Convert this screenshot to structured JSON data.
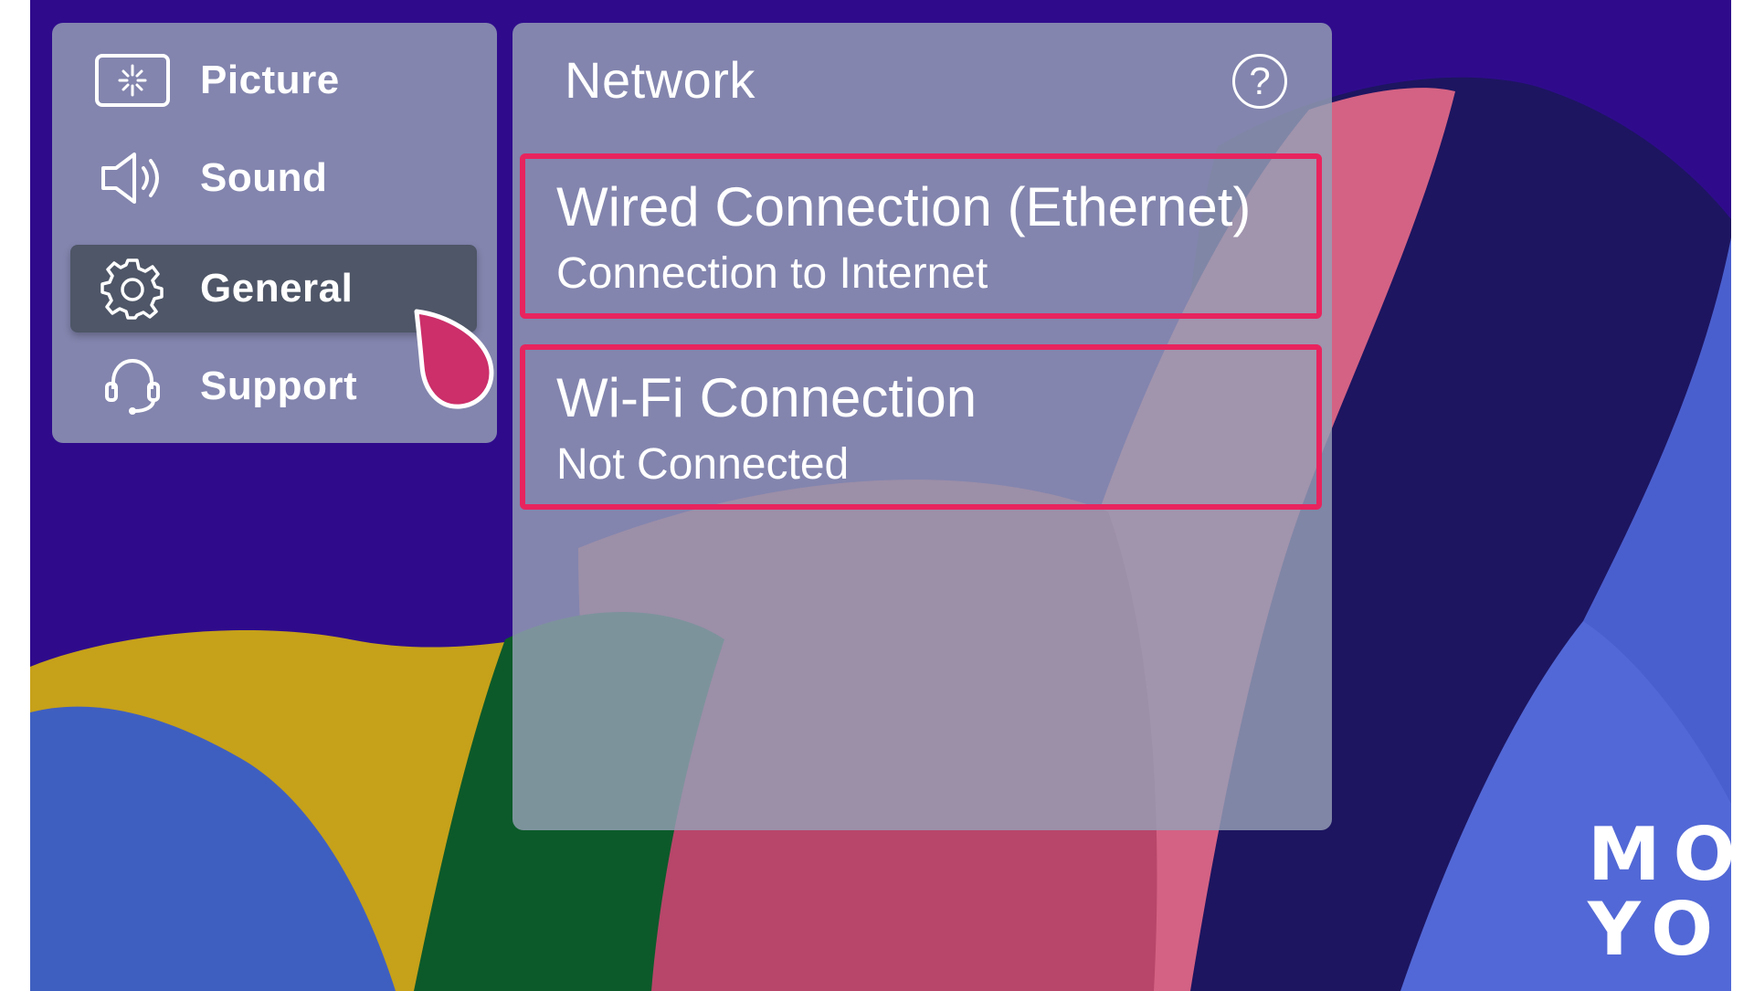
{
  "sidebar": {
    "items": [
      {
        "label": "Picture",
        "icon": "picture-icon",
        "selected": false
      },
      {
        "label": "Sound",
        "icon": "speaker-icon",
        "selected": false
      },
      {
        "label": "General",
        "icon": "gear-icon",
        "selected": true
      },
      {
        "label": "Support",
        "icon": "headset-icon",
        "selected": false
      }
    ]
  },
  "network": {
    "title": "Network",
    "help_icon": "question-icon",
    "help_symbol": "?",
    "options": [
      {
        "title": "Wired Connection (Ethernet)",
        "subtitle": "Connection to Internet"
      },
      {
        "title": "Wi-Fi Connection",
        "subtitle": "Not Connected"
      }
    ]
  },
  "colors": {
    "highlight_border": "#e8245e",
    "pointer": "#cc2f6a",
    "selected_item": "#4e5667",
    "background": "#2f0b8c"
  },
  "watermark": {
    "line1": "MO",
    "line2": "YO"
  }
}
